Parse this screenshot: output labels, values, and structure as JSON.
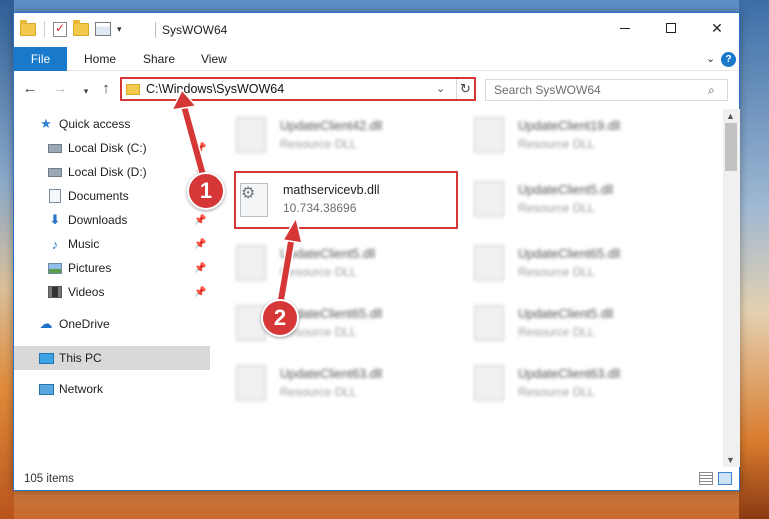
{
  "window": {
    "title": "SysWOW64",
    "minimize": "—",
    "maximize": "☐",
    "close": "✕"
  },
  "ribbon": {
    "tabs": [
      "File",
      "Home",
      "Share",
      "View"
    ],
    "expand_icon": "chevron-down-icon",
    "help": "?"
  },
  "nav": {
    "back": "←",
    "forward": "→",
    "recent": "▾",
    "up": "↑"
  },
  "address": {
    "path": "C:\\Windows\\SysWOW64",
    "dropdown": "⌄",
    "refresh": "↻"
  },
  "search": {
    "placeholder": "Search SysWOW64",
    "icon": "⌕"
  },
  "sidebar": {
    "items": [
      {
        "label": "Quick access",
        "icon": "star-icon",
        "pinned": false
      },
      {
        "label": "Local Disk (C:)",
        "icon": "drive-icon",
        "pinned": true
      },
      {
        "label": "Local Disk (D:)",
        "icon": "drive-icon",
        "pinned": true
      },
      {
        "label": "Documents",
        "icon": "documents-icon",
        "pinned": true
      },
      {
        "label": "Downloads",
        "icon": "download-icon",
        "pinned": true
      },
      {
        "label": "Music",
        "icon": "music-icon",
        "pinned": true
      },
      {
        "label": "Pictures",
        "icon": "pictures-icon",
        "pinned": true
      },
      {
        "label": "Videos",
        "icon": "videos-icon",
        "pinned": true
      },
      {
        "label": "OneDrive",
        "icon": "cloud-icon",
        "pinned": false
      },
      {
        "label": "This PC",
        "icon": "computer-icon",
        "pinned": false,
        "selected": true
      },
      {
        "label": "Network",
        "icon": "network-icon",
        "pinned": false
      }
    ]
  },
  "files": [
    {
      "name": "UpdateClient42.dll",
      "desc": "Resource DLL"
    },
    {
      "name": "UpdateClient19.dll",
      "desc": "Resource DLL"
    },
    {
      "name": "mathservicevb.dll",
      "desc": "10.734.38696",
      "highlighted": true
    },
    {
      "name": "UpdateClient5.dll",
      "desc": "Resource DLL"
    },
    {
      "name": "UpdateClient5.dll",
      "desc": "Resource DLL"
    },
    {
      "name": "UpdateClient65.dll",
      "desc": "Resource DLL"
    },
    {
      "name": "UpdateClient65.dll",
      "desc": "Resource DLL"
    },
    {
      "name": "UpdateClient5.dll",
      "desc": "Resource DLL"
    },
    {
      "name": "UpdateClient63.dll",
      "desc": "Resource DLL"
    },
    {
      "name": "UpdateClient63.dll",
      "desc": "Resource DLL"
    }
  ],
  "status": {
    "item_count": "105 items"
  },
  "annotations": {
    "step1": "1",
    "step2": "2",
    "color": "#d53737"
  }
}
